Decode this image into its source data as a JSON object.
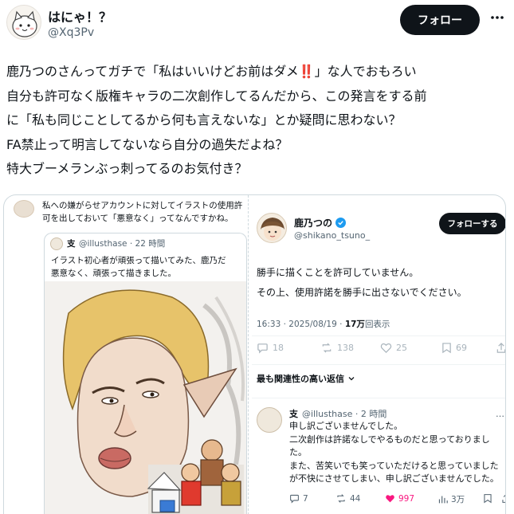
{
  "tweet": {
    "author_name": "はにゃ！？",
    "author_handle": "@Xq3Pv",
    "follow_label": "フォロー",
    "text_lines": [
      "鹿乃つのさんってガチで「私はいいけどお前はダメ‼️」な人でおもろい",
      "自分も許可なく版権キャラの二次創作してるんだから、この発言をする前",
      "に「私も同じことしてるから何も言えないな」とか疑問に思わない？",
      "FA禁止って明言してないなら自分の過失だよね？",
      "特大ブーメランぶっ刺ってるのお気付き？"
    ]
  },
  "left_post": {
    "text_lines": [
      "私への嫌がらせアカウントに対してイラストの使用許",
      "可を出しておいて「悪意なく」ってなんですかね。"
    ],
    "inner_quote": {
      "name": "支",
      "meta": "@illusthase · 22 時間",
      "text_lines": [
        "イラスト初心者が頑張って描いてみた、鹿乃だ",
        "悪意なく、頑張って描きました。"
      ]
    }
  },
  "right_post": {
    "name": "鹿乃つの",
    "handle": "@shikano_tsuno_",
    "follow_label": "フォローする",
    "body_lines": [
      "勝手に描くことを許可していません。",
      "その上、使用許諾を勝手に出さないでください。"
    ],
    "time": "16:33 · 2025/08/19 · ",
    "views_value": "17万",
    "views_label": "回表示",
    "actions": {
      "replies": "18",
      "reposts": "138",
      "likes": "25",
      "bookmarks": "69"
    },
    "sort_label": "最も関連性の高い返信",
    "reply": {
      "name": "支",
      "meta": "@illusthase · 2 時間",
      "more": "…",
      "text_lines": [
        "申し訳ございませんでした。",
        "二次創作は許諾なしでやるものだと思っておりまし",
        "た。",
        "また、苦笑いでも笑っていただけると思っていました",
        "が不快にさせてしまい、申し訳ございませんでした。"
      ],
      "actions": {
        "replies": "7",
        "reposts": "44",
        "likes": "997",
        "views": "3万"
      }
    }
  },
  "colors": {
    "like_active": "#f91880",
    "verified": "#1d9bf0",
    "hair": "#e7c36a"
  }
}
